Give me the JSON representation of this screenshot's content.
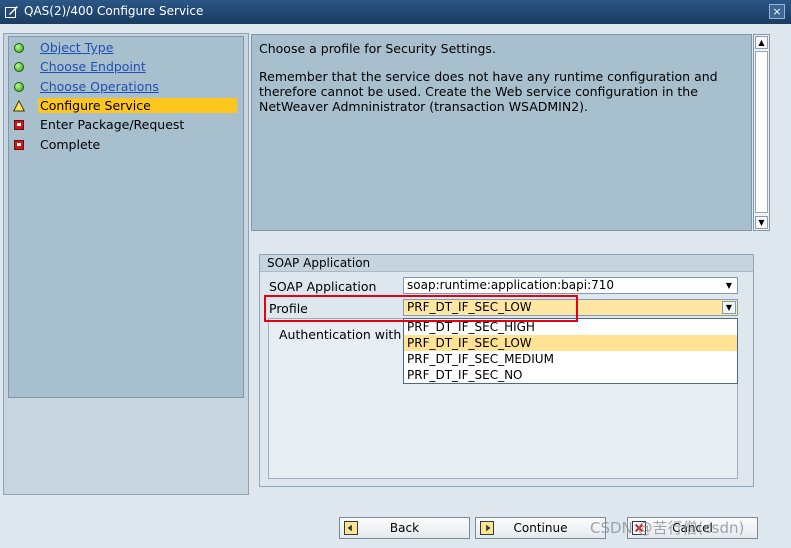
{
  "window": {
    "title": "QAS(2)/400 Configure Service",
    "close_glyph": "×"
  },
  "steps": [
    {
      "label": "Object Type",
      "status": "done",
      "link": true
    },
    {
      "label": "Choose Endpoint",
      "status": "done",
      "link": true
    },
    {
      "label": "Choose Operations",
      "status": "done",
      "link": true
    },
    {
      "label": "Configure Service",
      "status": "current",
      "link": false
    },
    {
      "label": "Enter Package/Request",
      "status": "pending",
      "link": false
    },
    {
      "label": "Complete",
      "status": "pending",
      "link": false
    }
  ],
  "info": {
    "line1": "Choose a profile for Security Settings.",
    "line2": "Remember that the service does not have any runtime configuration and therefore cannot be used. Create the Web service configuration in the NetWeaver Admninistrator (transaction WSADMIN2)."
  },
  "group": {
    "title": "SOAP Application",
    "soap_label": "SOAP Application",
    "soap_value": "soap:runtime:application:bapi:710",
    "profile_label": "Profile",
    "profile_value": "PRF_DT_IF_SEC_LOW",
    "auth_label": "Authentication with Us"
  },
  "dropdown": {
    "options": [
      "PRF_DT_IF_SEC_HIGH",
      "PRF_DT_IF_SEC_LOW",
      "PRF_DT_IF_SEC_MEDIUM",
      "PRF_DT_IF_SEC_NO"
    ],
    "highlighted": "PRF_DT_IF_SEC_LOW"
  },
  "buttons": {
    "back": "Back",
    "continue": "Continue",
    "cancel": "Cancel"
  },
  "watermark": "CSDN @苦行僧(csdn)",
  "colors": {
    "title_bar": "#1f4470",
    "active_step": "#ffc61e",
    "link": "#1f4fb6",
    "highlight_box": "#e60012"
  }
}
